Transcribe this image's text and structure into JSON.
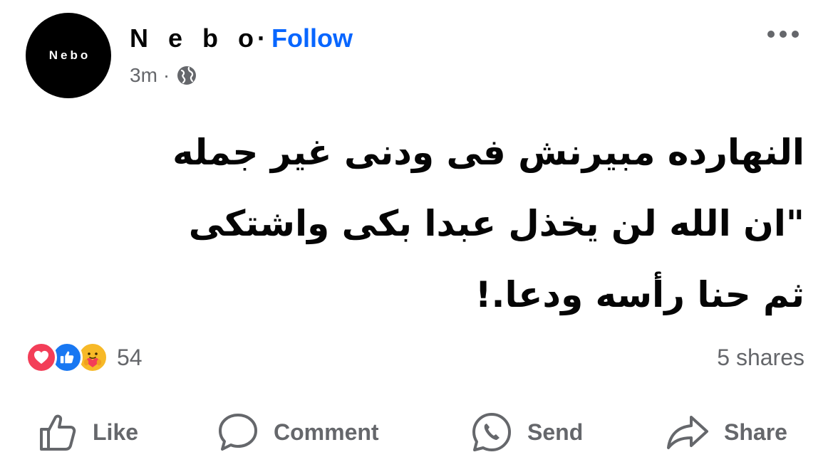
{
  "post": {
    "author": {
      "avatar_text": "Nebo",
      "name": "N e b o",
      "separator": "·",
      "follow_label": "Follow"
    },
    "meta": {
      "timestamp": "3m",
      "separator": "·",
      "audience_icon": "globe-icon"
    },
    "more_icon": "more-options-icon",
    "text_lines": [
      "النهارده مبيرنش فى ودنى غير جمله",
      "\"ان الله لن يخذل عبدا بكى واشتكى",
      "ثم حنا رأسه ودعا.!"
    ],
    "reactions": {
      "icons": [
        "love-icon",
        "like-icon",
        "care-icon"
      ],
      "count": "54"
    },
    "shares": "5 shares",
    "actions": [
      {
        "icon": "like-icon",
        "label": "Like"
      },
      {
        "icon": "comment-icon",
        "label": "Comment"
      },
      {
        "icon": "send-icon",
        "label": "Send"
      },
      {
        "icon": "share-icon",
        "label": "Share"
      }
    ]
  },
  "colors": {
    "text": "#050505",
    "secondary": "#65676b",
    "follow": "#0866ff",
    "love": "#f33e58",
    "like": "#1877f2",
    "care": "#f7b928"
  }
}
